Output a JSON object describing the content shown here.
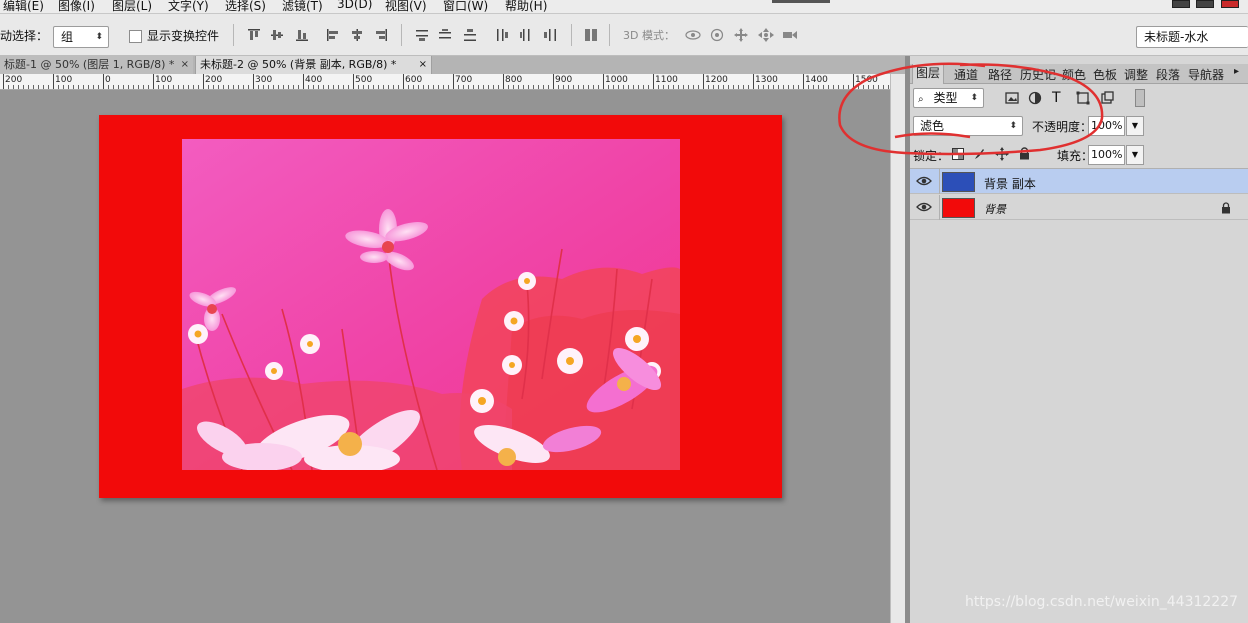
{
  "menu": {
    "items": [
      "编辑(E)",
      "图像(I)",
      "图层(L)",
      "文字(Y)",
      "选择(S)",
      "滤镜(T)",
      "3D(D)",
      "视图(V)",
      "窗口(W)",
      "帮助(H)"
    ]
  },
  "options": {
    "auto_select_label": "动选择：",
    "auto_select_value": "组",
    "show_transform_label": "显示变换控件",
    "mode_3d_label": "3D 模式：",
    "workspace_value": "未标题-水水"
  },
  "tabs": [
    {
      "label": "标题-1 @ 50% (图层 1, RGB/8) *",
      "close": "×"
    },
    {
      "label": "未标题-2 @ 50% (背景 副本, RGB/8) *",
      "close": "×"
    }
  ],
  "ruler": {
    "labels": [
      "200",
      "100",
      "0",
      "100",
      "200",
      "300",
      "400",
      "500",
      "600",
      "700",
      "800",
      "900",
      "1000",
      "1100",
      "1200",
      "1300",
      "1400",
      "1500"
    ]
  },
  "panel": {
    "tabs": [
      "图层",
      "通道",
      "路径",
      "历史记",
      "颜色",
      "色板",
      "调整",
      "段落",
      "导航器"
    ],
    "filter_value": "类型",
    "blend_mode": "滤色",
    "opacity_label": "不透明度：",
    "opacity_value": "100%",
    "lock_label": "锁定：",
    "fill_label": "填充：",
    "fill_value": "100%",
    "layers": [
      {
        "name": "背景 副本",
        "selected": true,
        "thumb": "#2c4fb8"
      },
      {
        "name": "背景",
        "selected": false,
        "thumb": "#f20a0a"
      }
    ]
  },
  "colors": {
    "doc_background": "#f20a0a",
    "annotation": "#e03030",
    "selection": "#b9cdf0"
  },
  "watermark": "https://blog.csdn.net/weixin_44312227"
}
